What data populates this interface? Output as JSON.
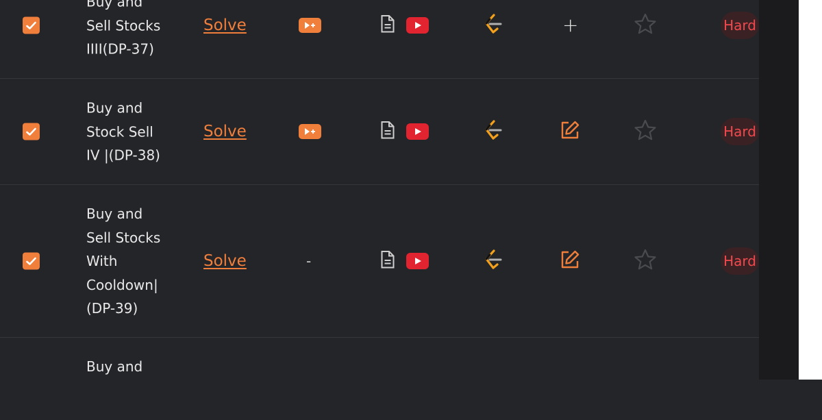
{
  "difficulty_color": "#f1494e",
  "accent_color": "#f07f3c",
  "rows": [
    {
      "title_lines": [
        "Buy and",
        "Sell Stocks",
        "IIII(DP-37)"
      ],
      "checked": true,
      "solve_label": "Solve",
      "premium_video": "youtube-plus-icon",
      "article_icon": "document-icon",
      "video_icon": "youtube-icon",
      "platform_icon": "leetcode-icon",
      "notes_icon": "plus-icon",
      "notes_label": "+",
      "star_icon": "star-outline-icon",
      "difficulty": "Hard"
    },
    {
      "title_lines": [
        "Buy and",
        "Stock Sell",
        "IV |(DP-38)"
      ],
      "checked": true,
      "solve_label": "Solve",
      "premium_video": "youtube-plus-icon",
      "article_icon": "document-icon",
      "video_icon": "youtube-icon",
      "platform_icon": "leetcode-icon",
      "notes_icon": "edit-note-icon",
      "star_icon": "star-outline-icon",
      "difficulty": "Hard"
    },
    {
      "title_lines": [
        "Buy and",
        "Sell Stocks",
        "With",
        "Cooldown|",
        "(DP-39)"
      ],
      "checked": true,
      "solve_label": "Solve",
      "premium_video_label": "-",
      "article_icon": "document-icon",
      "video_icon": "youtube-icon",
      "platform_icon": "leetcode-icon",
      "notes_icon": "edit-note-icon",
      "star_icon": "star-outline-icon",
      "difficulty": "Hard"
    },
    {
      "title_lines": [
        "Buy and"
      ]
    }
  ]
}
